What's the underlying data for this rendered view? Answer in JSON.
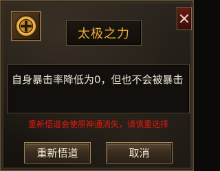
{
  "skill": {
    "icon": "taiji-plus-icon",
    "name": "太极之力",
    "description": "自身暴击率降低为0，但也不会被暴击"
  },
  "warning": "重新悟道会使原神通消失，请慎重选择",
  "buttons": {
    "confirm": "重新悟道",
    "cancel": "取消"
  },
  "colors": {
    "title": "#f0b030",
    "warning": "#e01a10",
    "text": "#ece8d8"
  }
}
